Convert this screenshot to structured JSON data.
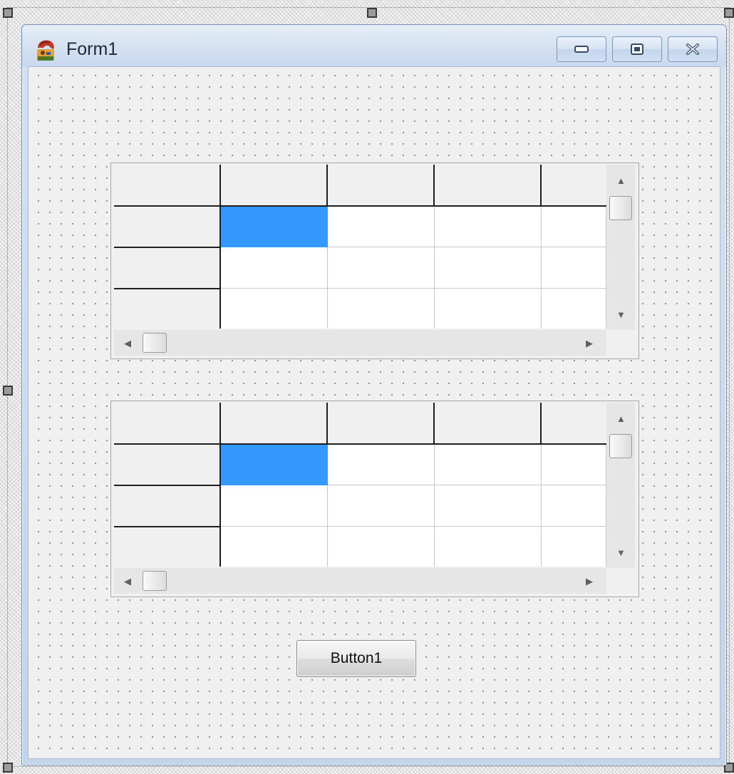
{
  "window": {
    "title": "Form1",
    "app_icon": "lazarus-cheetah-icon",
    "caption_buttons": [
      "minimize-icon",
      "maximize-icon",
      "close-icon"
    ]
  },
  "grids": [
    {
      "name": "grid-1",
      "columns": 5,
      "rows": 4,
      "fixed_cols": 1,
      "fixed_rows": 1,
      "selected_cell": {
        "row": 1,
        "col": 1
      }
    },
    {
      "name": "grid-2",
      "columns": 5,
      "rows": 4,
      "fixed_cols": 1,
      "fixed_rows": 1,
      "selected_cell": {
        "row": 1,
        "col": 1
      }
    }
  ],
  "button1": {
    "label": "Button1"
  },
  "colors": {
    "selection": "#3399ff",
    "titlebar": "#d4e1f1",
    "grid_lines_fixed": "#1e1e1e",
    "grid_lines_normal": "#c8c8c8"
  }
}
